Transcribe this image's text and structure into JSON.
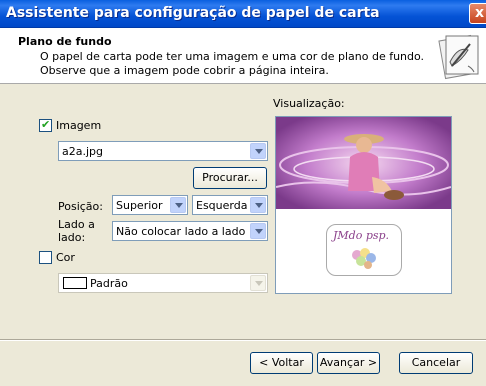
{
  "window": {
    "title": "Assistente para configuração de papel de carta",
    "close_glyph": "x"
  },
  "header": {
    "title": "Plano de fundo",
    "description": "O papel de carta pode ter uma imagem e uma cor de plano de fundo. Observe que a imagem pode cobrir a página inteira.",
    "icon": "stationery-icon"
  },
  "image_section": {
    "checkbox_label": "Imagem",
    "checked": true,
    "file_value": "a2a.jpg",
    "browse_label": "Procurar...",
    "position_label": "Posição:",
    "vertical_value": "Superior",
    "horizontal_value": "Esquerda",
    "tile_label_line1": "Lado a",
    "tile_label_line2": "lado:",
    "tile_value": "Não colocar lado a lado"
  },
  "color_section": {
    "checkbox_label": "Cor",
    "checked": false,
    "color_value": "Padrão"
  },
  "preview": {
    "label": "Visualização:",
    "logo_text": "JMdo psp."
  },
  "buttons": {
    "back": "< Voltar",
    "next": "Avançar >",
    "cancel": "Cancelar"
  },
  "colors": {
    "titlebar": "#0553d6",
    "banner": "#9a4fa6",
    "face": "#ece9d8"
  }
}
